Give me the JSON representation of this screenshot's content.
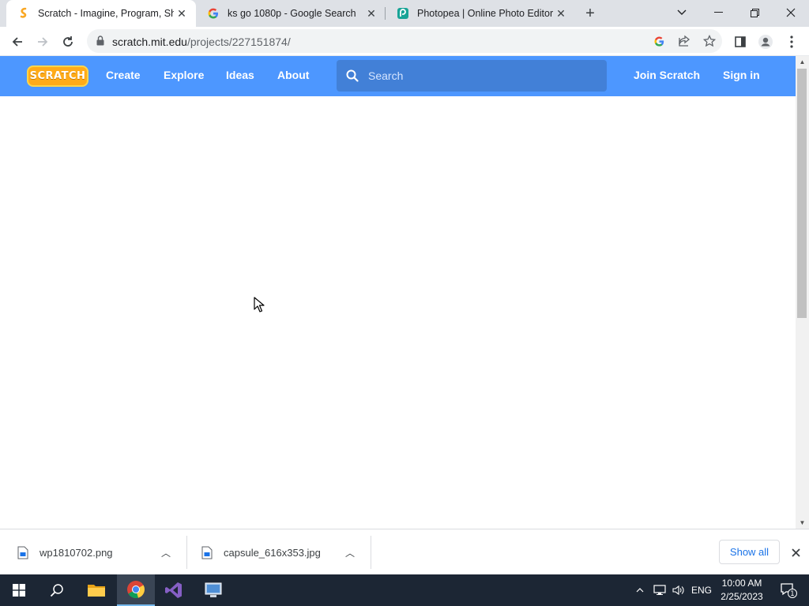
{
  "browser": {
    "tabs": [
      {
        "title": "Scratch - Imagine, Program, Share",
        "active": true
      },
      {
        "title": "ks go 1080p - Google Search",
        "active": false
      },
      {
        "title": "Photopea | Online Photo Editor",
        "active": false
      }
    ],
    "url_host": "scratch.mit.edu",
    "url_path": "/projects/227151874/"
  },
  "scratch": {
    "logo": "SCRATCH",
    "nav": [
      "Create",
      "Explore",
      "Ideas",
      "About"
    ],
    "search_placeholder": "Search",
    "join": "Join Scratch",
    "signin": "Sign in",
    "brand_color": "#4d97ff"
  },
  "downloads": {
    "items": [
      "wp1810702.png",
      "capsule_616x353.jpg"
    ],
    "show_all": "Show all"
  },
  "taskbar": {
    "language": "ENG",
    "time": "10:00 AM",
    "date": "2/25/2023",
    "notification_count": "1"
  }
}
